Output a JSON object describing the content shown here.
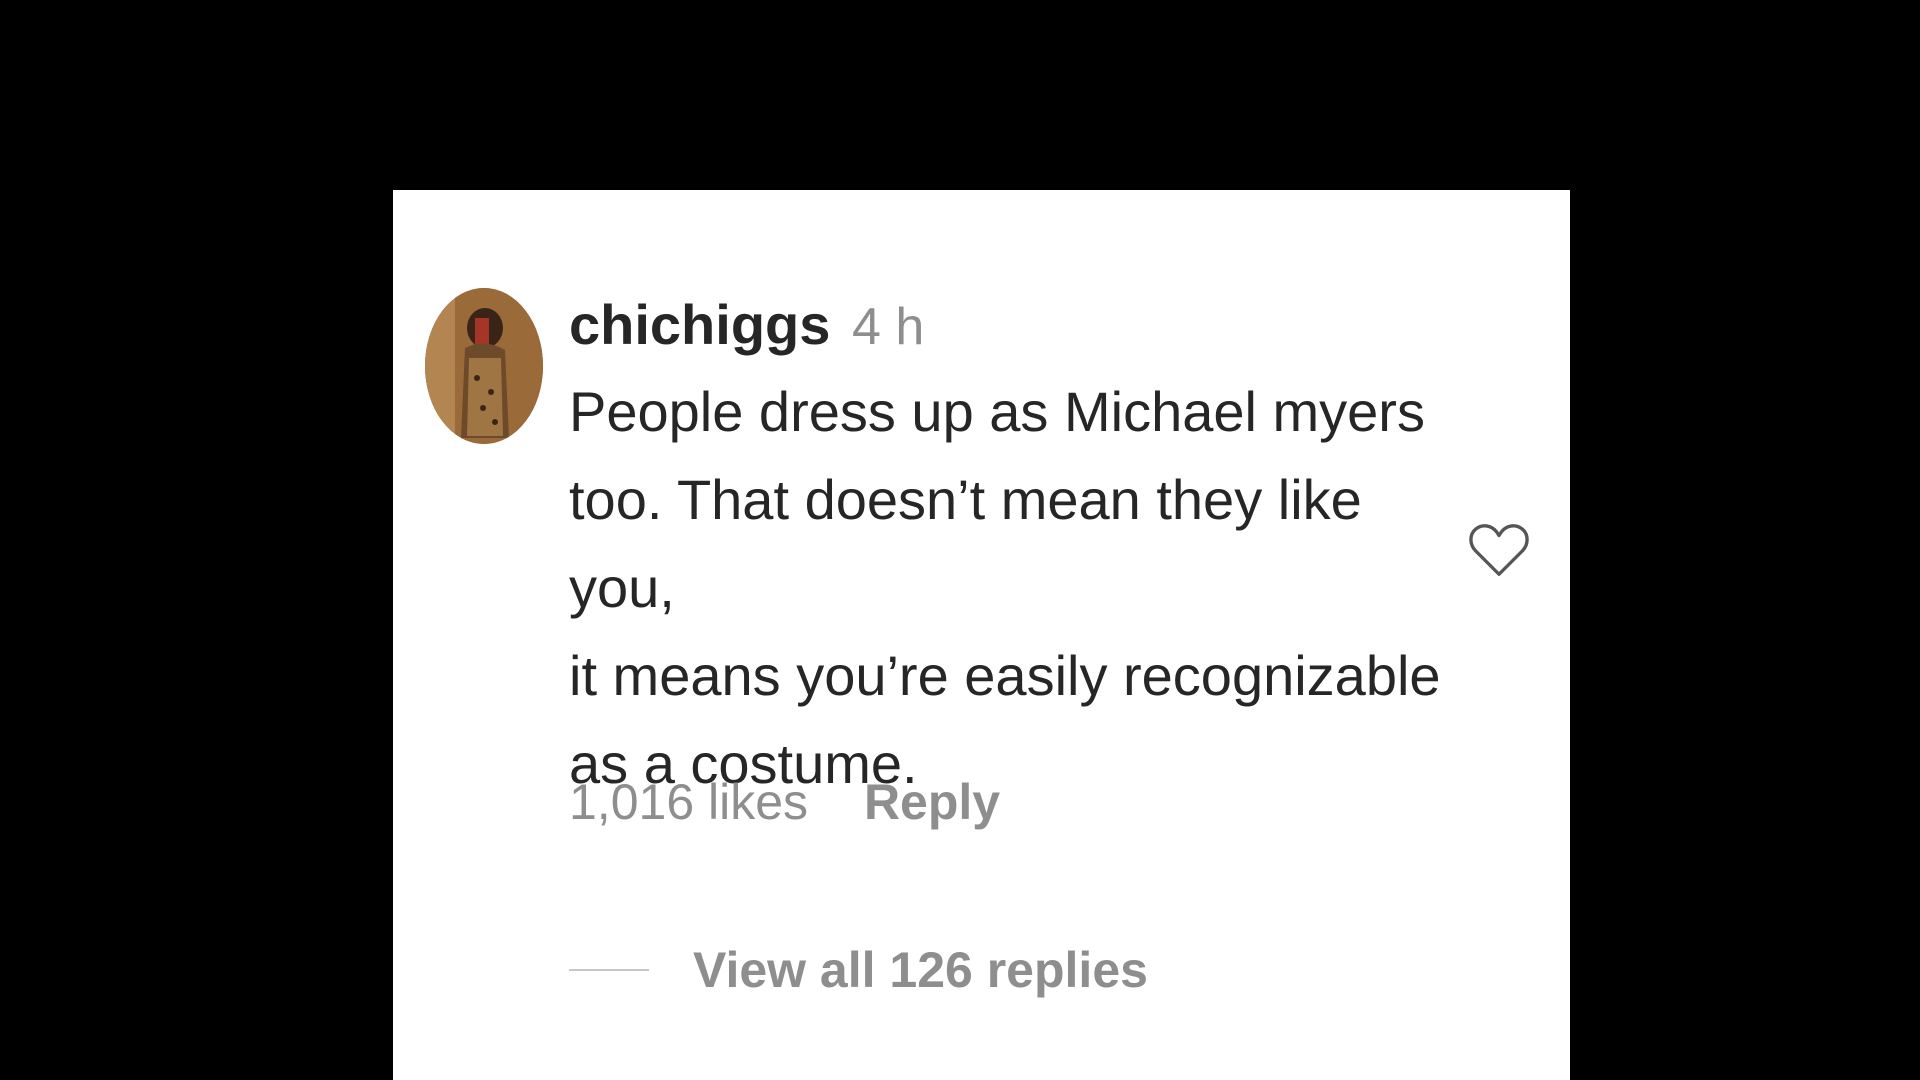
{
  "comment": {
    "username": "chichiggs",
    "time": "4 h",
    "lines": [
      "People dress up as Michael myers",
      "too. That doesn’t mean they like you,",
      "it means you’re easily recognizable",
      "as a costume."
    ],
    "likes": "1,016 likes",
    "reply_label": "Reply",
    "view_replies_label": "View all 126 replies"
  },
  "icons": {
    "like": "heart-icon",
    "avatar": "avatar"
  },
  "colors": {
    "background": "#000000",
    "card": "#ffffff",
    "text_primary": "#262626",
    "text_secondary": "#8e8e8e"
  }
}
